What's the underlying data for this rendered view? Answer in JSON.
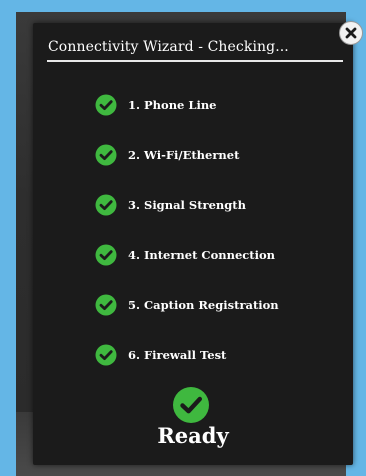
{
  "dialog": {
    "title": "Connectivity Wizard - Checking...",
    "close_icon": "close-icon"
  },
  "checks": [
    {
      "label": "1. Phone Line",
      "status": "passed",
      "icon": "check-circle-icon"
    },
    {
      "label": "2. Wi-Fi/Ethernet",
      "status": "passed",
      "icon": "check-circle-icon"
    },
    {
      "label": "3. Signal Strength",
      "status": "passed",
      "icon": "check-circle-icon"
    },
    {
      "label": "4. Internet Connection",
      "status": "passed",
      "icon": "check-circle-icon"
    },
    {
      "label": "5. Caption Registration",
      "status": "passed",
      "icon": "check-circle-icon"
    },
    {
      "label": "6. Firewall Test",
      "status": "passed",
      "icon": "check-circle-icon"
    }
  ],
  "result": {
    "label": "Ready",
    "icon": "check-circle-icon"
  },
  "colors": {
    "page_background": "#64b6e6",
    "dialog_background": "#1b1b1b",
    "check_green": "#3fb83f",
    "text": "#ffffff"
  }
}
